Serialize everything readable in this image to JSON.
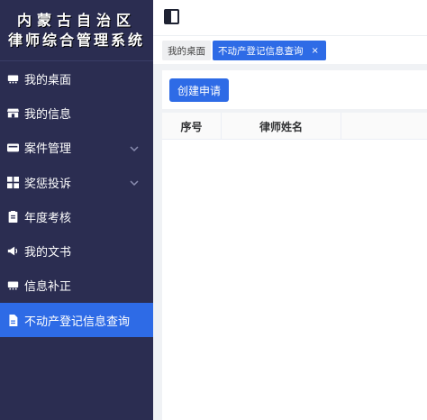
{
  "brand": {
    "line1": "内蒙古自治区",
    "line2": "律师综合管理系统"
  },
  "sidebar": {
    "items": [
      {
        "label": "我的桌面",
        "icon": "desktop-icon",
        "expandable": false,
        "active": false
      },
      {
        "label": "我的信息",
        "icon": "store-icon",
        "expandable": false,
        "active": false
      },
      {
        "label": "案件管理",
        "icon": "case-icon",
        "expandable": true,
        "active": false
      },
      {
        "label": "奖惩投诉",
        "icon": "grid-icon",
        "expandable": true,
        "active": false
      },
      {
        "label": "年度考核",
        "icon": "clipboard-icon",
        "expandable": false,
        "active": false
      },
      {
        "label": "我的文书",
        "icon": "megaphone-icon",
        "expandable": false,
        "active": false
      },
      {
        "label": "信息补正",
        "icon": "desktop-icon",
        "expandable": false,
        "active": false
      },
      {
        "label": "不动产登记信息查询",
        "icon": "document-icon",
        "expandable": false,
        "active": true
      }
    ]
  },
  "tabs": {
    "home": "我的桌面",
    "active": "不动产登记信息查询",
    "close": "×"
  },
  "main": {
    "create_button": "创建申请",
    "table": {
      "columns": [
        "序号",
        "律师姓名",
        ""
      ]
    }
  },
  "colors": {
    "sidebar_bg": "#2b2d51",
    "accent": "#2e6be6",
    "page_bg": "#f0f2f5"
  }
}
